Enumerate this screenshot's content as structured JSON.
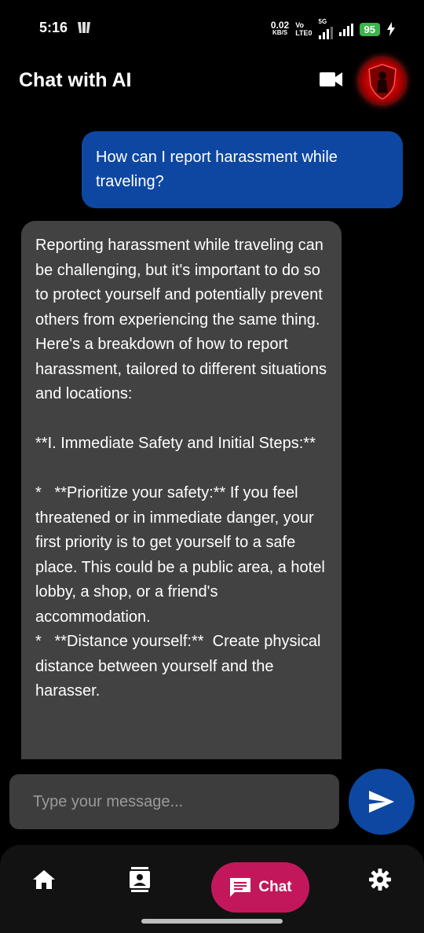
{
  "status_bar": {
    "time": "5:16",
    "net_speed_value": "0.02",
    "net_speed_unit": "KB/S",
    "volte_top": "Vo",
    "volte_bottom": "LTE0",
    "network": "5G",
    "battery": "95"
  },
  "header": {
    "title": "Chat with AI"
  },
  "messages": {
    "user": "How can I report harassment while traveling?",
    "ai": "Reporting harassment while traveling can be challenging, but it's important to do so to protect yourself and potentially prevent others from experiencing the same thing. Here's a breakdown of how to report harassment, tailored to different situations and locations:\n\n**I. Immediate Safety and Initial Steps:**\n\n*   **Prioritize your safety:** If you feel threatened or in immediate danger, your first priority is to get yourself to a safe place. This could be a public area, a hotel lobby, a shop, or a friend's accommodation.\n*   **Distance yourself:**  Create physical distance between yourself and the harasser."
  },
  "composer": {
    "placeholder": "Type your message..."
  },
  "nav": {
    "chat_label": "Chat"
  },
  "colors": {
    "user_bubble": "#0d47a1",
    "ai_bubble": "#424242",
    "chat_pill": "#c2185b",
    "battery": "#3ab54a"
  }
}
